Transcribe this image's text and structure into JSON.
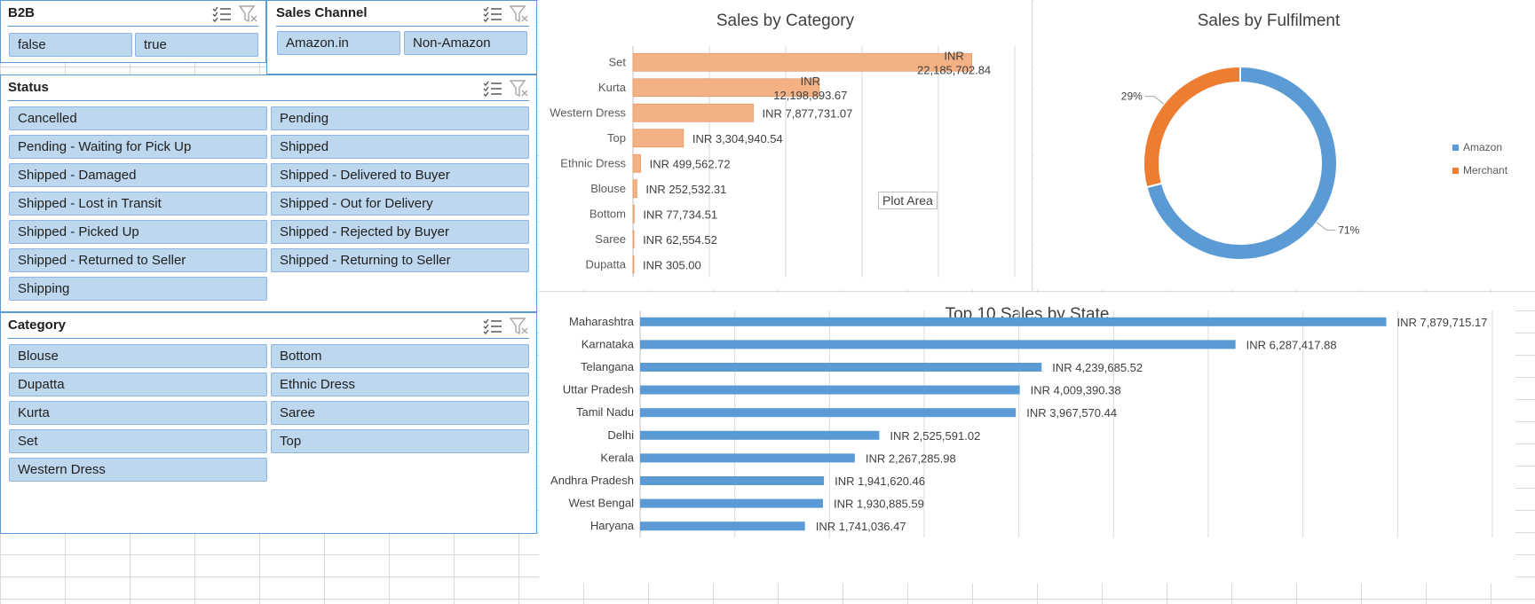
{
  "slicers": {
    "b2b": {
      "title": "B2B",
      "items": [
        "false",
        "true"
      ]
    },
    "sales_channel": {
      "title": "Sales Channel",
      "items": [
        "Amazon.in",
        "Non-Amazon"
      ]
    },
    "status": {
      "title": "Status",
      "items": [
        "Cancelled",
        "Pending",
        "Pending - Waiting for Pick Up",
        "Shipped",
        "Shipped - Damaged",
        "Shipped - Delivered to Buyer",
        "Shipped - Lost in Transit",
        "Shipped - Out for Delivery",
        "Shipped - Picked Up",
        "Shipped - Rejected by Buyer",
        "Shipped - Returned to Seller",
        "Shipped - Returning to Seller",
        "Shipping"
      ]
    },
    "category": {
      "title": "Category",
      "items": [
        "Blouse",
        "Bottom",
        "Dupatta",
        "Ethnic Dress",
        "Kurta",
        "Saree",
        "Set",
        "Top",
        "Western Dress"
      ]
    }
  },
  "plot_area_label": "Plot Area",
  "colors": {
    "category_bar": "#f4b183",
    "state_bar": "#5b9bd5",
    "amazon": "#5b9bd5",
    "merchant": "#ed7d31",
    "slicer_button": "#bdd7ee"
  },
  "chart_data": [
    {
      "type": "bar",
      "title": "Sales by Category",
      "categories": [
        "Set",
        "Kurta",
        "Western Dress",
        "Top",
        "Ethnic Dress",
        "Blouse",
        "Bottom",
        "Saree",
        "Dupatta"
      ],
      "values": [
        22185702.84,
        12198893.67,
        7877731.07,
        3304940.54,
        499562.72,
        252532.31,
        77734.51,
        62554.52,
        305.0
      ],
      "data_labels": [
        "INR 22,185,702.84",
        "INR 12,198,893.67",
        "INR 7,877,731.07",
        "INR 3,304,940.54",
        "INR 499,562.72",
        "INR 252,532.31",
        "INR 77,734.51",
        "INR 62,554.52",
        "INR 305.00"
      ],
      "xlim": [
        0,
        25000000
      ],
      "grid": true
    },
    {
      "type": "pie",
      "title": "Sales by Fulfilment",
      "categories": [
        "Amazon",
        "Merchant"
      ],
      "values": [
        71,
        29
      ],
      "data_labels": [
        "71%",
        "29%"
      ],
      "legend": "right"
    },
    {
      "type": "bar",
      "title": "Top 10 Sales by State",
      "categories": [
        "Maharashtra",
        "Karnataka",
        "Telangana",
        "Uttar Pradesh",
        "Tamil Nadu",
        "Delhi",
        "Kerala",
        "Andhra Pradesh",
        "West Bengal",
        "Haryana"
      ],
      "values": [
        7879715.17,
        6287417.88,
        4239685.52,
        4009390.38,
        3967570.44,
        2525591.02,
        2267285.98,
        1941620.46,
        1930885.59,
        1741036.47
      ],
      "data_labels": [
        "INR 7,879,715.17",
        "INR 6,287,417.88",
        "INR 4,239,685.52",
        "INR 4,009,390.38",
        "INR 3,967,570.44",
        "INR 2,525,591.02",
        "INR 2,267,285.98",
        "INR 1,941,620.46",
        "INR 1,930,885.59",
        "INR 1,741,036.47"
      ],
      "xlim": [
        0,
        9000000
      ],
      "grid": true
    }
  ]
}
